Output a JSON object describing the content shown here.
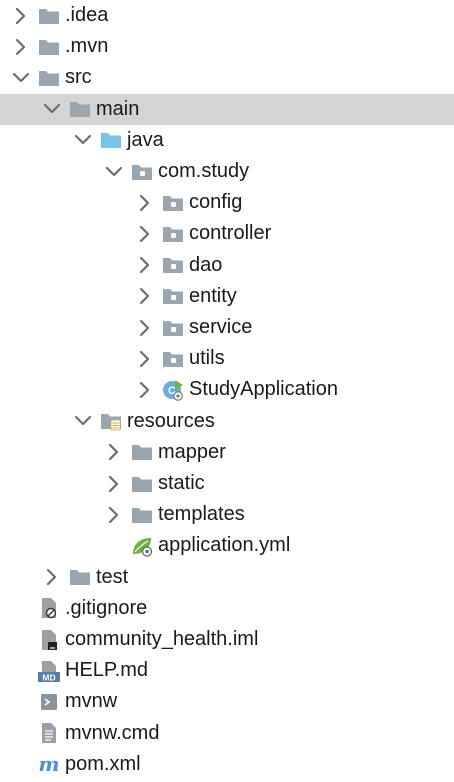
{
  "tree": [
    {
      "label": ".idea",
      "depth": 0,
      "expandable": true,
      "expanded": false,
      "icon": "folder-icon"
    },
    {
      "label": ".mvn",
      "depth": 0,
      "expandable": true,
      "expanded": false,
      "icon": "folder-icon"
    },
    {
      "label": "src",
      "depth": 0,
      "expandable": true,
      "expanded": true,
      "icon": "folder-icon"
    },
    {
      "label": "main",
      "depth": 1,
      "expandable": true,
      "expanded": true,
      "icon": "folder-icon",
      "selected": true
    },
    {
      "label": "java",
      "depth": 2,
      "expandable": true,
      "expanded": true,
      "icon": "source-folder-icon"
    },
    {
      "label": "com.study",
      "depth": 3,
      "expandable": true,
      "expanded": true,
      "icon": "package-icon"
    },
    {
      "label": "config",
      "depth": 4,
      "expandable": true,
      "expanded": false,
      "icon": "package-icon"
    },
    {
      "label": "controller",
      "depth": 4,
      "expandable": true,
      "expanded": false,
      "icon": "package-icon"
    },
    {
      "label": "dao",
      "depth": 4,
      "expandable": true,
      "expanded": false,
      "icon": "package-icon"
    },
    {
      "label": "entity",
      "depth": 4,
      "expandable": true,
      "expanded": false,
      "icon": "package-icon"
    },
    {
      "label": "service",
      "depth": 4,
      "expandable": true,
      "expanded": false,
      "icon": "package-icon"
    },
    {
      "label": "utils",
      "depth": 4,
      "expandable": true,
      "expanded": false,
      "icon": "package-icon"
    },
    {
      "label": "StudyApplication",
      "depth": 4,
      "expandable": true,
      "expanded": false,
      "icon": "spring-class-icon"
    },
    {
      "label": "resources",
      "depth": 2,
      "expandable": true,
      "expanded": true,
      "icon": "resources-folder-icon"
    },
    {
      "label": "mapper",
      "depth": 3,
      "expandable": true,
      "expanded": false,
      "icon": "folder-icon"
    },
    {
      "label": "static",
      "depth": 3,
      "expandable": true,
      "expanded": false,
      "icon": "folder-icon"
    },
    {
      "label": "templates",
      "depth": 3,
      "expandable": true,
      "expanded": false,
      "icon": "folder-icon"
    },
    {
      "label": "application.yml",
      "depth": 3,
      "expandable": false,
      "expanded": false,
      "icon": "spring-yml-icon"
    },
    {
      "label": "test",
      "depth": 1,
      "expandable": true,
      "expanded": false,
      "icon": "folder-icon"
    },
    {
      "label": ".gitignore",
      "depth": 0,
      "expandable": false,
      "expanded": false,
      "icon": "gitignore-file-icon"
    },
    {
      "label": "community_health.iml",
      "depth": 0,
      "expandable": false,
      "expanded": false,
      "icon": "iml-file-icon"
    },
    {
      "label": "HELP.md",
      "depth": 0,
      "expandable": false,
      "expanded": false,
      "icon": "markdown-file-icon"
    },
    {
      "label": "mvnw",
      "depth": 0,
      "expandable": false,
      "expanded": false,
      "icon": "shell-file-icon"
    },
    {
      "label": "mvnw.cmd",
      "depth": 0,
      "expandable": false,
      "expanded": false,
      "icon": "text-file-icon"
    },
    {
      "label": "pom.xml",
      "depth": 0,
      "expandable": false,
      "expanded": false,
      "icon": "maven-file-icon"
    }
  ],
  "colors": {
    "selection": "#d4d4d4",
    "folder": "#9aa7b0",
    "source_folder": "#7ac3e8",
    "chevron": "#6e6e6e",
    "spring": "#6db33f",
    "maven": "#4a8fd8"
  }
}
